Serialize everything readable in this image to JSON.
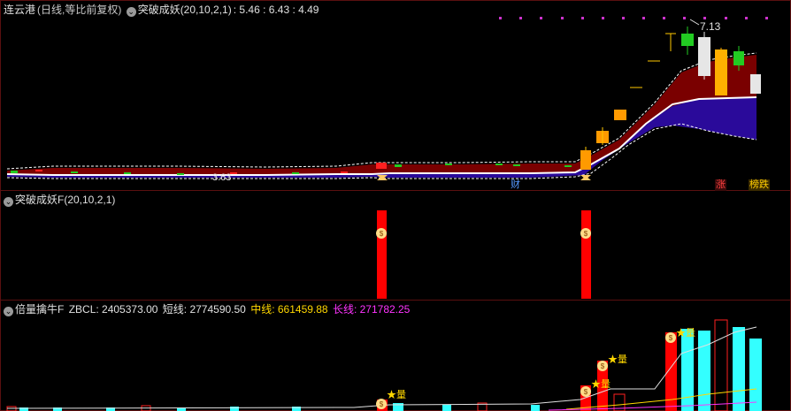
{
  "panel1": {
    "stock_name": "连云港",
    "period": "(日线,等比前复权)",
    "indicator": "突破成妖(20,10,2,1)",
    "values": ": 5.46 : 6.43 : 4.49",
    "high_label": "7.13",
    "low_label": "3.63",
    "marker_cai": "财",
    "marker_zhang": "涨",
    "marker_bang": "榜跌"
  },
  "panel2": {
    "indicator": "突破成妖F(20,10,2,1)"
  },
  "panel3": {
    "indicator": "倍量擒牛F",
    "zbcl_label": "ZBCL: 2405373.00",
    "short_label": "短线: 2774590.50",
    "mid_label": "中线: 661459.88",
    "long_label": "长线: 271782.25",
    "vol_mark": "★量"
  },
  "colors": {
    "up": "#ff2020",
    "down": "#22cc22",
    "band_top": "#7a0000",
    "band_bottom": "#2a0a9a",
    "mid_line": "#ffffff",
    "cyan_bar": "#33ffff",
    "yellow_text": "#ffd700",
    "magenta_text": "#ff33ff"
  }
}
